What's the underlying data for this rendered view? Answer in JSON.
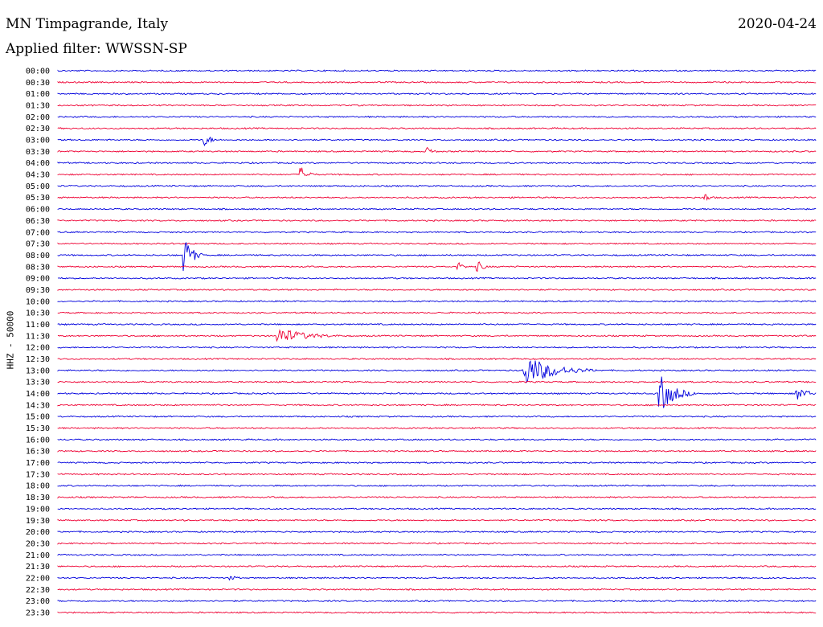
{
  "header": {
    "station": "MN Timpagrande, Italy",
    "date": "2020-04-24",
    "filter": "Applied filter: WWSSN-SP"
  },
  "chart_data": {
    "type": "line",
    "ylabel": "HHZ - 50000",
    "rows": [
      "00:00",
      "00:30",
      "01:00",
      "01:30",
      "02:00",
      "02:30",
      "03:00",
      "03:30",
      "04:00",
      "04:30",
      "05:00",
      "05:30",
      "06:00",
      "06:30",
      "07:00",
      "07:30",
      "08:00",
      "08:30",
      "09:00",
      "09:30",
      "10:00",
      "10:30",
      "11:00",
      "11:30",
      "12:00",
      "12:30",
      "13:00",
      "13:30",
      "14:00",
      "14:30",
      "15:00",
      "15:30",
      "16:00",
      "16:30",
      "17:00",
      "17:30",
      "18:00",
      "18:30",
      "19:00",
      "19:30",
      "20:00",
      "20:30",
      "21:00",
      "21:30",
      "22:00",
      "22:30",
      "23:00",
      "23:30"
    ],
    "colors": {
      "even": "#0000dd",
      "odd": "#ee0033"
    },
    "events": [
      {
        "row": "03:00",
        "minute": 5.8,
        "duration": 0.6,
        "amplitude": 7
      },
      {
        "row": "03:30",
        "minute": 14.6,
        "duration": 0.6,
        "amplitude": 5
      },
      {
        "row": "04:30",
        "minute": 9.6,
        "duration": 0.7,
        "amplitude": 9
      },
      {
        "row": "05:30",
        "minute": 25.6,
        "duration": 0.5,
        "amplitude": 5
      },
      {
        "row": "08:00",
        "minute": 5.0,
        "duration": 0.8,
        "amplitude": 20
      },
      {
        "row": "08:30",
        "minute": 15.8,
        "duration": 0.6,
        "amplitude": 5
      },
      {
        "row": "08:30",
        "minute": 16.6,
        "duration": 0.6,
        "amplitude": 6
      },
      {
        "row": "11:30",
        "minute": 8.7,
        "duration": 3.0,
        "amplitude": 10
      },
      {
        "row": "13:00",
        "minute": 18.4,
        "duration": 3.0,
        "amplitude": 20
      },
      {
        "row": "14:00",
        "minute": 23.8,
        "duration": 1.5,
        "amplitude": 22
      },
      {
        "row": "14:00",
        "minute": 29.2,
        "duration": 1.2,
        "amplitude": 8
      },
      {
        "row": "22:00",
        "minute": 6.8,
        "duration": 0.8,
        "amplitude": 3
      }
    ]
  }
}
